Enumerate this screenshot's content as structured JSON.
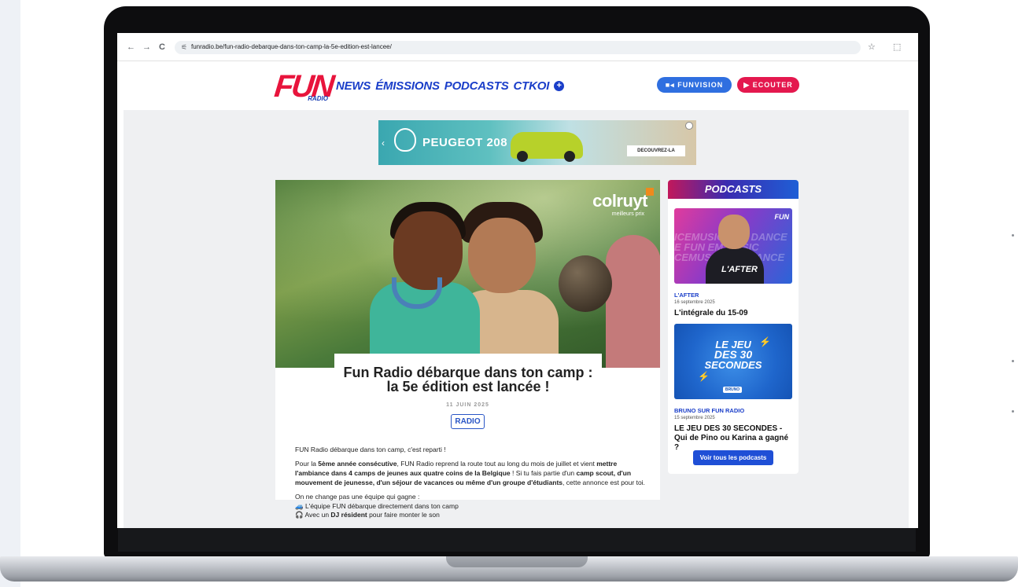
{
  "browser": {
    "back": "←",
    "forward": "→",
    "reload": "C",
    "url": "funradio.be/fun-radio-debarque-dans-ton-camp-la-5e-edition-est-lancee/",
    "star": "☆",
    "ext": "⬚"
  },
  "header": {
    "logo_main": "FUN",
    "logo_sub": "RADIO",
    "nav": [
      "NEWS",
      "ÉMISSIONS",
      "PODCASTS",
      "CTKOI"
    ],
    "more": "+",
    "funvision": "FUNVISION",
    "listen": "ECOUTER"
  },
  "ad": {
    "brand": "PEUGEOT 208",
    "cta": "DECOUVREZ-LA"
  },
  "article": {
    "image_brand": "colruyt",
    "image_tagline": "meilleurs prix",
    "title_line1": "Fun Radio débarque dans ton camp :",
    "title_line2": "la 5e édition est lancée !",
    "date": "11 JUIN 2025",
    "tag": "RADIO",
    "intro": "FUN Radio débarque dans ton camp, c'est reparti !",
    "p2_a": "Pour la ",
    "p2_b": "5ème année consécutive",
    "p2_c": ", FUN Radio reprend la route tout au long du mois de juillet et vient ",
    "p2_d": "mettre l'ambiance dans 4 camps de jeunes aux quatre coins de la Belgique",
    "p2_e": " ! Si tu fais partie d'un ",
    "p2_f": "camp scout, d'un mouvement de jeunesse, d'un séjour de vacances ou même d'un groupe d'étudiants",
    "p2_g": ", cette annonce est pour toi.",
    "p3": "On ne change pas une équipe qui gagne :",
    "li1": "L'équipe FUN débarque directement dans ton camp",
    "li2_a": "Avec un ",
    "li2_b": "DJ résident",
    "li2_c": " pour faire monter le son"
  },
  "sidebar": {
    "heading": "PODCASTS",
    "items": [
      {
        "show": "L'AFTER",
        "date": "16 septembre 2025",
        "title": "L'intégrale du 15-09",
        "image_text": "L'AFTER",
        "image_brand": "FUN"
      },
      {
        "show": "BRUNO SUR FUN RADIO",
        "date": "15 septembre 2025",
        "title": "LE JEU DES 30 SECONDES - Qui de Pino ou Karina a gagné ?",
        "image_text_1": "LE JEU",
        "image_text_2": "DES 30",
        "image_text_3": "SECONDES",
        "image_tag": "BRUNO"
      }
    ],
    "all_button": "Voir tous les podcasts"
  }
}
